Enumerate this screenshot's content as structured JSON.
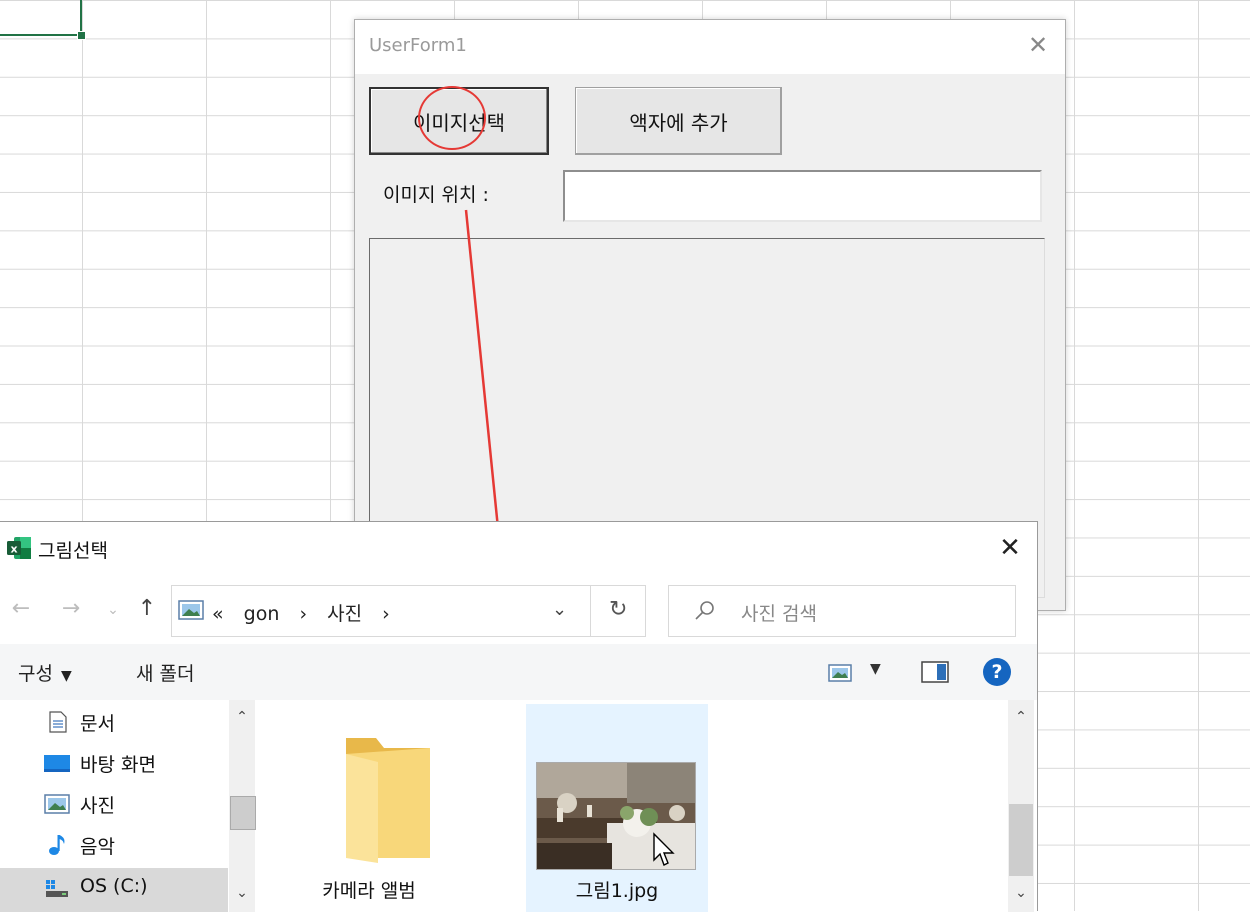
{
  "userform": {
    "title": "UserForm1",
    "select_image_label": "이미지선택",
    "add_to_frame_label": "액자에 추가",
    "image_location_label": "이미지 위치 :",
    "image_location_value": ""
  },
  "dialog": {
    "title": "그림선택",
    "breadcrumb": [
      "«",
      "gon",
      "›",
      "사진",
      "›"
    ],
    "search_placeholder": "사진 검색",
    "toolbar": {
      "organize_label": "구성",
      "new_folder_label": "새 폴더",
      "help_label": "?"
    },
    "nav_items": [
      {
        "label": "문서",
        "icon": "document-icon"
      },
      {
        "label": "바탕 화면",
        "icon": "desktop-icon"
      },
      {
        "label": "사진",
        "icon": "pictures-icon"
      },
      {
        "label": "음악",
        "icon": "music-icon"
      },
      {
        "label": "OS (C:)",
        "icon": "drive-icon",
        "selected": true
      }
    ],
    "files": [
      {
        "label": "카메라 앨범",
        "type": "folder"
      },
      {
        "label": "그림1.jpg",
        "type": "image",
        "selected": true
      }
    ]
  },
  "colors": {
    "excel_green": "#217346",
    "annotation_red": "#e53935",
    "selection_blue": "#e5f3ff",
    "help_blue": "#1565c0"
  }
}
